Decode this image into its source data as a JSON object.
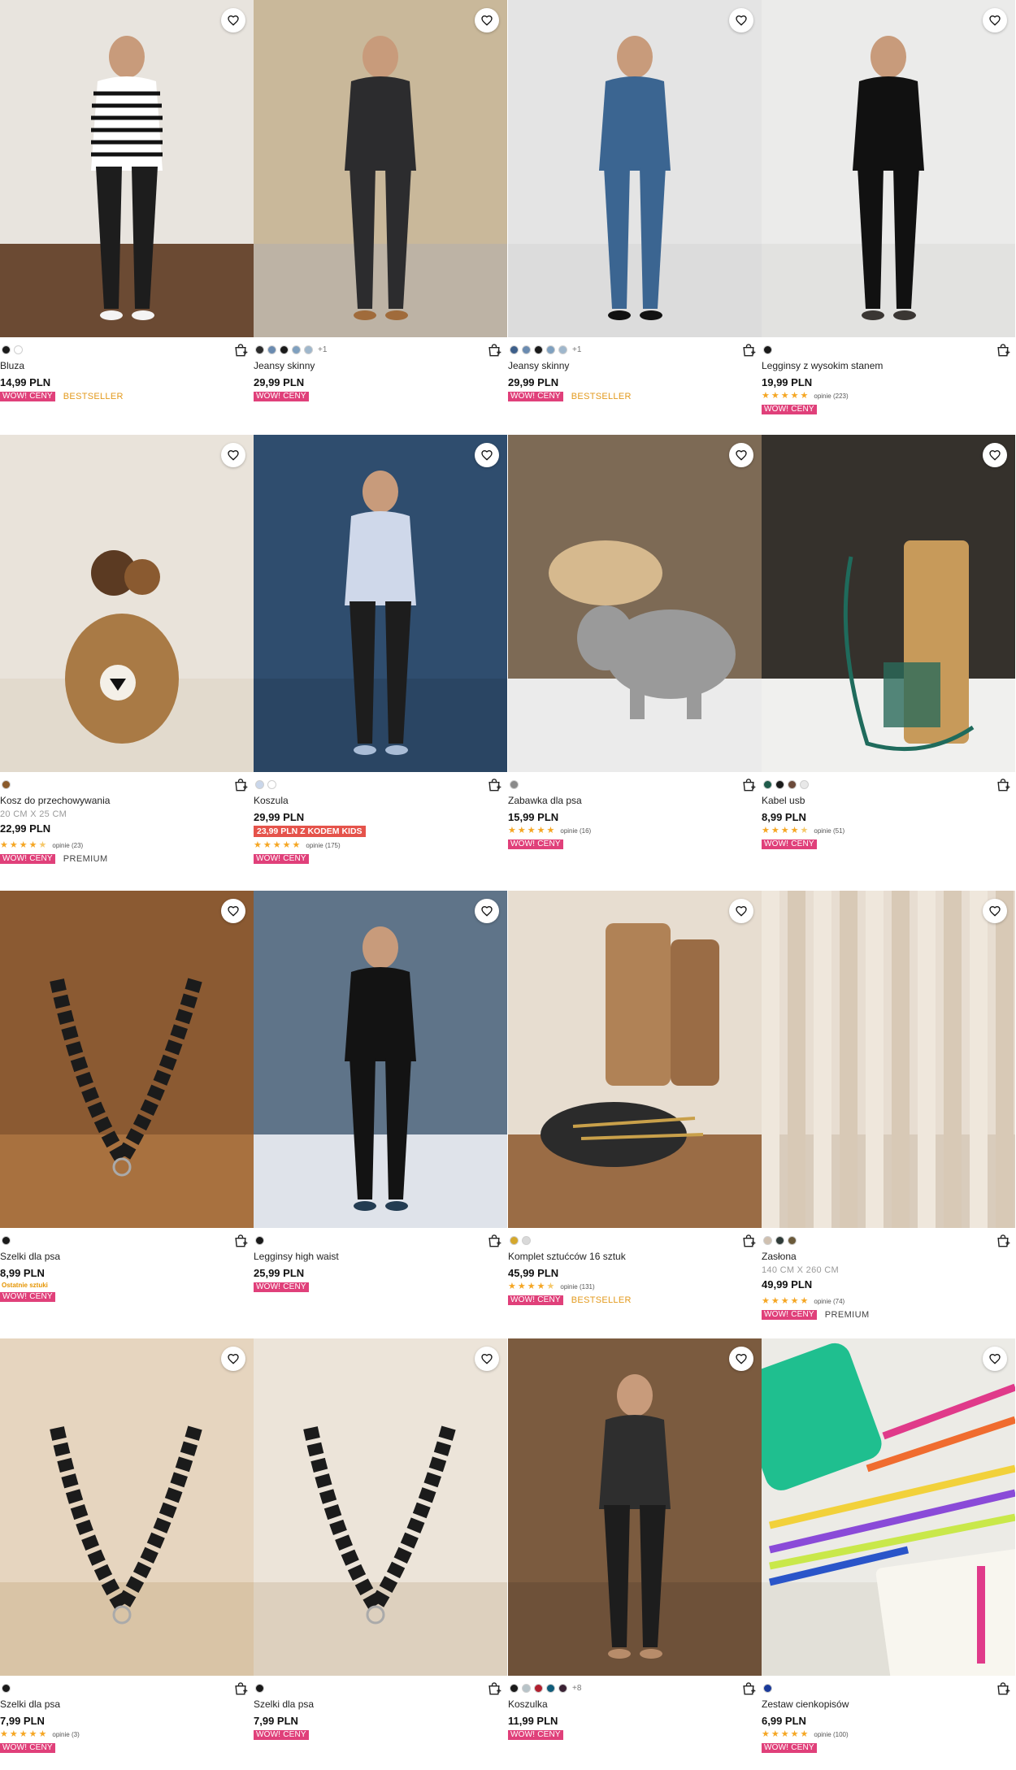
{
  "wishlist_icon": "heart-outline-icon",
  "cart_icon": "add-to-cart-bag-icon",
  "products": [
    {
      "name": "Bluza",
      "price": "14,99 PLN",
      "swatches": [
        "#1a1a1a",
        "#ffffff"
      ],
      "more": "",
      "badges": {
        "wow": "WOW! CENY",
        "tag": "BESTSELLER",
        "tag_type": "best"
      },
      "image": {
        "bg": "#e8e4de",
        "floor": "#6b4a33",
        "subject": "#1d1d1d",
        "accent": "#f4f4f4"
      }
    },
    {
      "name": "Jeansy skinny",
      "price": "29,99 PLN",
      "swatches": [
        "#2b2b2b",
        "#6a8bb0",
        "#1a1a1a",
        "#7fa0bf",
        "#9fb7cc"
      ],
      "more": "+1",
      "badges": {
        "wow": "WOW! CENY",
        "tag": "",
        "tag_type": ""
      },
      "image": {
        "bg": "#c9b89a",
        "floor": "#bdb3a5",
        "subject": "#2c2c2e",
        "accent": "#a06b3b"
      }
    },
    {
      "name": "Jeansy skinny",
      "price": "29,99 PLN",
      "swatches": [
        "#3d5f8a",
        "#6a8bb0",
        "#1a1a1a",
        "#7fa0bf",
        "#9fb7cc"
      ],
      "more": "+1",
      "badges": {
        "wow": "WOW! CENY",
        "tag": "BESTSELLER",
        "tag_type": "best"
      },
      "image": {
        "bg": "#e4e4e4",
        "floor": "#dcdcdc",
        "subject": "#3b6591",
        "accent": "#111111"
      }
    },
    {
      "name": "Legginsy z wysokim stanem",
      "price": "19,99 PLN",
      "swatches": [
        "#1a1a1a"
      ],
      "more": "",
      "rating": {
        "stars": 5,
        "half": false,
        "text": "opinie (223)"
      },
      "badges": {
        "wow": "WOW! CENY",
        "tag": "",
        "tag_type": ""
      },
      "image": {
        "bg": "#ebebea",
        "floor": "#e2e2e0",
        "subject": "#111111",
        "accent": "#3a3633"
      }
    },
    {
      "name": "Kosz do przechowywania",
      "dims": "20 CM X 25 CM",
      "price": "22,99 PLN",
      "swatches": [
        "#8a5a2b"
      ],
      "more": "",
      "rating": {
        "stars": 4,
        "half": true,
        "text": "opinie (23)"
      },
      "badges": {
        "wow": "WOW! CENY",
        "tag": "PREMIUM",
        "tag_type": "prem"
      },
      "image": {
        "bg": "#e9e3da",
        "floor": "#e2dacd",
        "subject": "#a97a45",
        "accent": "#5b3a22"
      }
    },
    {
      "name": "Koszula",
      "price": "29,99 PLN",
      "promo": "23,99 PLN Z KODEM KIDS",
      "swatches": [
        "#c9d6ea",
        "#ffffff"
      ],
      "more": "",
      "rating": {
        "stars": 5,
        "half": false,
        "text": "opinie (175)"
      },
      "badges": {
        "wow": "WOW! CENY",
        "tag": "",
        "tag_type": ""
      },
      "image": {
        "bg": "#2f4d6e",
        "floor": "#2a4563",
        "subject": "#cfd8ea",
        "accent": "#a9bcd6"
      }
    },
    {
      "name": "Zabawka dla psa",
      "price": "15,99 PLN",
      "swatches": [
        "#8a8a8a"
      ],
      "more": "",
      "rating": {
        "stars": 5,
        "half": false,
        "text": "opinie (16)"
      },
      "badges": {
        "wow": "WOW! CENY",
        "tag": "",
        "tag_type": ""
      },
      "image": {
        "bg": "#7d6a55",
        "floor": "#ebebeb",
        "subject": "#9a9a9a",
        "accent": "#d6b98e"
      }
    },
    {
      "name": "Kabel usb",
      "price": "8,99 PLN",
      "swatches": [
        "#1f5b4a",
        "#1a1a1a",
        "#6b4a3a",
        "#e8e8e8"
      ],
      "more": "",
      "rating": {
        "stars": 4,
        "half": true,
        "text": "opinie (51)"
      },
      "badges": {
        "wow": "WOW! CENY",
        "tag": "",
        "tag_type": ""
      },
      "image": {
        "bg": "#35312c",
        "floor": "#f0f0ee",
        "subject": "#c79a5a",
        "accent": "#1f6b5c"
      }
    },
    {
      "name": "Szelki dla psa",
      "price": "8,99 PLN",
      "lastitems": "Ostatnie sztuki",
      "swatches": [
        "#1a1a1a"
      ],
      "more": "",
      "badges": {
        "wow": "WOW! CENY",
        "tag": "",
        "tag_type": ""
      },
      "image": {
        "bg": "#8b5a32",
        "floor": "#a8713f",
        "subject": "#1b1b1b",
        "accent": "#d0d0d0"
      }
    },
    {
      "name": "Legginsy high waist",
      "price": "25,99 PLN",
      "swatches": [
        "#1a1a1a"
      ],
      "more": "",
      "badges": {
        "wow": "WOW! CENY",
        "tag": "",
        "tag_type": ""
      },
      "image": {
        "bg": "#5f7489",
        "floor": "#dfe3ea",
        "subject": "#131313",
        "accent": "#233c52"
      }
    },
    {
      "name": "Komplet sztućców 16 sztuk",
      "price": "45,99 PLN",
      "swatches": [
        "#d4a72c",
        "#d9d9d9"
      ],
      "more": "",
      "rating": {
        "stars": 4,
        "half": true,
        "text": "opinie (131)"
      },
      "badges": {
        "wow": "WOW! CENY",
        "tag": "BESTSELLER",
        "tag_type": "best"
      },
      "image": {
        "bg": "#e7ddd0",
        "floor": "#9a6c45",
        "subject": "#2b2b2b",
        "accent": "#c9a04a"
      }
    },
    {
      "name": "Zasłona",
      "dims": "140 CM X 260 CM",
      "price": "49,99 PLN",
      "swatches": [
        "#cfc0b0",
        "#2f3b38",
        "#6b5a3a"
      ],
      "more": "",
      "rating": {
        "stars": 5,
        "half": false,
        "text": "opinie (74)"
      },
      "badges": {
        "wow": "WOW! CENY",
        "tag": "PREMIUM",
        "tag_type": "prem"
      },
      "image": {
        "bg": "#e7ddd1",
        "floor": "#d9ccbc",
        "subject": "#d8c9b6",
        "accent": "#efe7dc"
      }
    },
    {
      "name": "Szelki dla psa",
      "price": "7,99 PLN",
      "swatches": [
        "#1a1a1a"
      ],
      "more": "",
      "rating": {
        "stars": 5,
        "half": false,
        "text": "opinie (3)"
      },
      "badges": {
        "wow": "WOW! CENY",
        "tag": "",
        "tag_type": ""
      },
      "image": {
        "bg": "#e6d5bf",
        "floor": "#d9c4a6",
        "subject": "#1b1b1b",
        "accent": "#c7ad89"
      }
    },
    {
      "name": "Szelki dla psa",
      "price": "7,99 PLN",
      "swatches": [
        "#1a1a1a"
      ],
      "more": "",
      "badges": {
        "wow": "WOW! CENY",
        "tag": "",
        "tag_type": ""
      },
      "image": {
        "bg": "#ece4d9",
        "floor": "#ddd0be",
        "subject": "#1b1b1b",
        "accent": "#c9b79c"
      }
    },
    {
      "name": "Koszulka",
      "price": "11,99 PLN",
      "swatches": [
        "#1a1a1a",
        "#b7c3c8",
        "#b11f2e",
        "#0f5c7a",
        "#3a2234"
      ],
      "more": "+8",
      "badges": {
        "wow": "WOW! CENY",
        "tag": "",
        "tag_type": ""
      },
      "image": {
        "bg": "#7b5b3f",
        "floor": "#6e5139",
        "subject": "#2e2e2e",
        "accent": "#b78c6a"
      }
    },
    {
      "name": "Zestaw cienkopisów",
      "price": "6,99 PLN",
      "swatches": [
        "#1a3a9a"
      ],
      "more": "",
      "rating": {
        "stars": 5,
        "half": false,
        "text": "opinie (100)"
      },
      "badges": {
        "wow": "WOW! CENY",
        "tag": "",
        "tag_type": ""
      },
      "image": {
        "bg": "#ecebe6",
        "floor": "#e2e0d8",
        "subject": "#1fbf8f",
        "accent": "#e03a8a"
      }
    }
  ]
}
